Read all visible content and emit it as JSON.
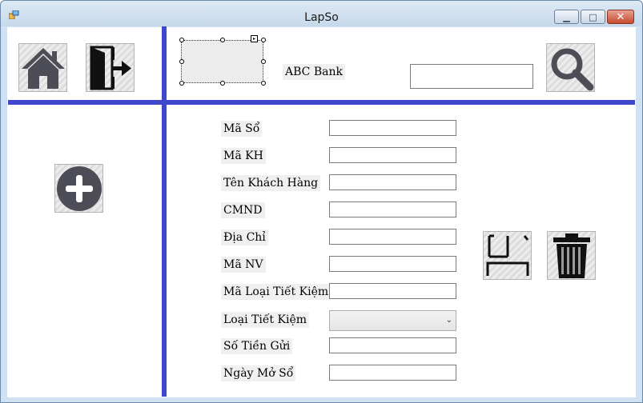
{
  "window": {
    "title": "LapSo",
    "minimize_glyph": "▁",
    "maximize_glyph": "□",
    "close_glyph": "✕"
  },
  "toolbar": {
    "bank_label": "ABC Bank",
    "search_value": "",
    "home_icon": "home-icon",
    "exit_icon": "exit-icon",
    "search_icon": "magnifier-icon"
  },
  "sidebar": {
    "add_icon": "plus-circle-icon"
  },
  "form": {
    "fields": [
      {
        "label": "Mã Sổ",
        "value": ""
      },
      {
        "label": "Mã KH",
        "value": ""
      },
      {
        "label": "Tên Khách Hàng",
        "value": ""
      },
      {
        "label": "CMND",
        "value": ""
      },
      {
        "label": "Địa Chỉ",
        "value": ""
      },
      {
        "label": "Mã NV",
        "value": ""
      },
      {
        "label": "Mã Loại Tiết Kiệm",
        "value": ""
      },
      {
        "label": "Loại Tiết Kiệm",
        "value": ""
      },
      {
        "label": "Số Tiền Gửi",
        "value": ""
      },
      {
        "label": "Ngày Mở Sổ",
        "value": ""
      }
    ]
  },
  "actions": {
    "save_icon": "save-icon",
    "delete_icon": "trash-icon"
  },
  "colors": {
    "divider": "#3f48cc",
    "icon_dark": "#4d4d57"
  }
}
